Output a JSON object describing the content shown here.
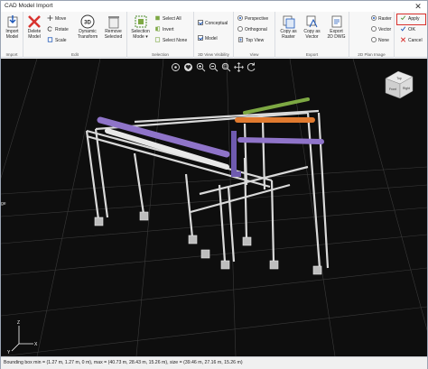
{
  "window": {
    "title": "CAD Model Import",
    "close_glyph": "✕"
  },
  "ribbon": {
    "import_group": {
      "label": "Import",
      "import_model": "Import\nModel"
    },
    "edit_group": {
      "label": "Edit",
      "delete_model": "Delete\nModel",
      "move": "Move",
      "rotate": "Rotate",
      "scale": "Scale",
      "dynamic_transform": "Dynamic\nTransform",
      "remove_selected": "Remove\nSelected"
    },
    "selection_group": {
      "label": "Selection",
      "selection_mode": "Selection\nMode ▾",
      "select_all": "Select All",
      "invert": "Invert",
      "select_none": "Select None"
    },
    "visibility_group": {
      "label": "3D View Visibility",
      "conceptual": "Conceptual",
      "model": "Model"
    },
    "view_group": {
      "label": "View",
      "perspective": "Perspective",
      "orthogonal": "Orthogonal",
      "top_view": "Top View"
    },
    "export_group": {
      "label": "Export",
      "copy_raster": "Copy as\nRaster",
      "copy_vector": "Copy as\nVector",
      "export_dwg": "Export\n2D DWG"
    },
    "plan_group": {
      "label": "2D Plan Image",
      "raster": "Raster",
      "vector": "Vector",
      "none": "None"
    },
    "actions": {
      "apply": "Apply",
      "ok": "OK",
      "cancel": "Cancel"
    }
  },
  "viewport": {
    "view_cube": {
      "top": "Top",
      "front": "Front",
      "right": "Right"
    },
    "axes": {
      "x": "X",
      "y": "Y",
      "z": "Z"
    },
    "edge_label": "ge"
  },
  "status": {
    "bounding_box": "Bounding box min = (1.27 m, 1.27 m, 0 m), max = (40.73 m, 28.43 m, 15.26 m), size = (39.46 m, 27.16 m, 15.26 m)"
  },
  "colors": {
    "accent": "#1b56b8",
    "ok_border": "#d9302c",
    "delete_red": "#d8332f",
    "pipe_purple": "#8f74c9",
    "pipe_orange": "#e07a2f",
    "pipe_green": "#7da843",
    "structure": "#d9d9d9"
  }
}
